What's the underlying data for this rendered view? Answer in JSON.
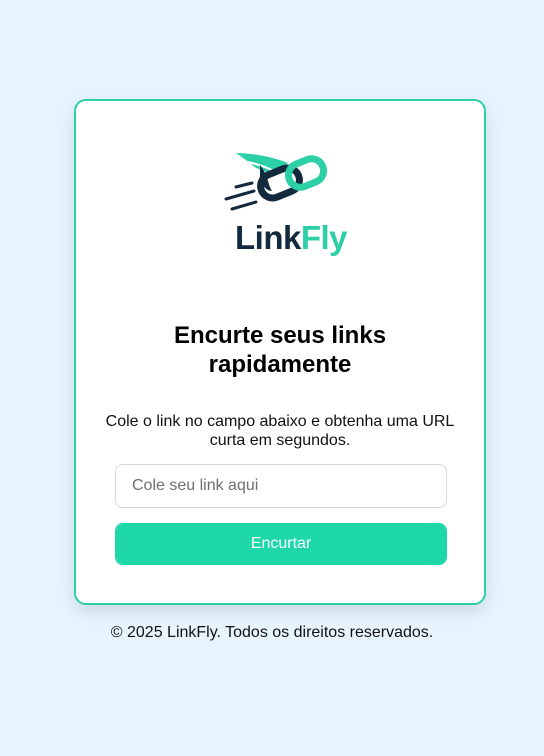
{
  "brand": {
    "name_part1": "Link",
    "name_part2": "Fly",
    "primary_color": "#2ccfa6",
    "dark_color": "#13293d",
    "logo_icon": "flying-chain-link-icon"
  },
  "hero": {
    "title": "Encurte seus links rapidamente",
    "subtitle": "Cole o link no campo abaixo e obtenha uma URL curta em segundos."
  },
  "form": {
    "url_placeholder": "Cole seu link aqui",
    "url_value": "",
    "submit_label": "Encurtar",
    "button_color": "#1fd8a9"
  },
  "footer": {
    "copyright": "© 2025 LinkFly. Todos os direitos reservados."
  },
  "theme": {
    "page_background": "#e8f4fd",
    "card_border": "#2ccfa6"
  }
}
